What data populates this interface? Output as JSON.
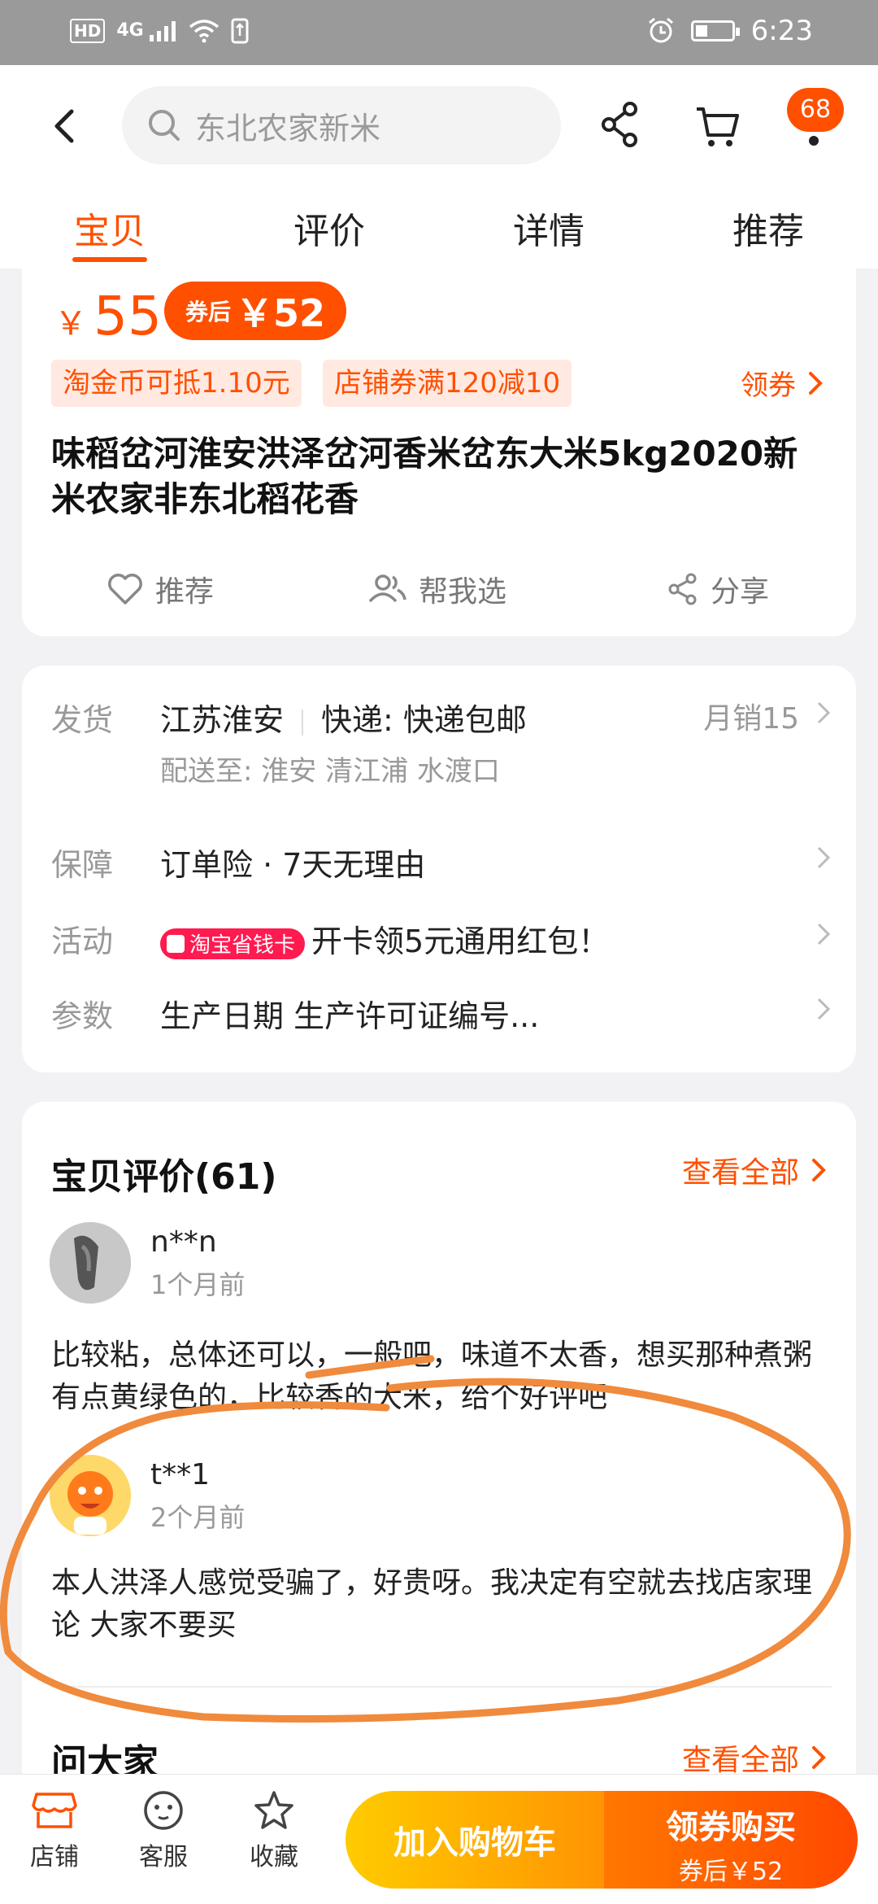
{
  "status_bar": {
    "hd": "HD",
    "network": "4G",
    "time": "6:23"
  },
  "header": {
    "search_placeholder": "东北农家新米",
    "cart_badge": "68",
    "tabs": [
      {
        "label": "宝贝",
        "active": true
      },
      {
        "label": "评价",
        "active": false
      },
      {
        "label": "详情",
        "active": false
      },
      {
        "label": "推荐",
        "active": false
      }
    ]
  },
  "product": {
    "price_symbol": "￥",
    "price": "55",
    "coupon_prefix": "券后",
    "coupon_price": "￥52",
    "tags": [
      "淘金币可抵1.10元",
      "店铺券满120减10"
    ],
    "get_coupon": "领券",
    "title": "味稻岔河淮安洪泽岔河香米岔东大米5kg2020新米农家非东北稻花香",
    "actions": {
      "recommend": "推荐",
      "help_choose": "帮我选",
      "share": "分享"
    }
  },
  "shipping": {
    "ship_label": "发货",
    "origin": "江苏淮安",
    "express": "快递: 快递包邮",
    "monthly_sales": "月销15",
    "deliver_to": "配送至: 淮安 清江浦 水渡口",
    "guarantee_label": "保障",
    "guarantee_value": "订单险 · 7天无理由",
    "activity_label": "活动",
    "activity_tag": "淘宝省钱卡",
    "activity_value": "开卡领5元通用红包！",
    "params_label": "参数",
    "params_value": "生产日期 生产许可证编号..."
  },
  "reviews": {
    "title": "宝贝评价(61)",
    "see_all": "查看全部",
    "items": [
      {
        "user": "n**n",
        "time": "1个月前",
        "text": "比较粘，总体还可以，一般吧，味道不太香，想买那种煮粥有点黄绿色的，比较香的大米，给个好评吧"
      },
      {
        "user": "t**1",
        "time": "2个月前",
        "text": "本人洪泽人感觉受骗了，好贵呀。我决定有空就去找店家理论 大家不要买"
      }
    ],
    "ask_title": "问大家",
    "ask_see_all": "查看全部"
  },
  "bottom_bar": {
    "shop": "店铺",
    "service": "客服",
    "favorite": "收藏",
    "add_to_cart": "加入购物车",
    "buy": "领券购买",
    "buy_sub": "券后￥52"
  },
  "colors": {
    "accent": "#ff5000",
    "annotation": "#f08a3c"
  }
}
